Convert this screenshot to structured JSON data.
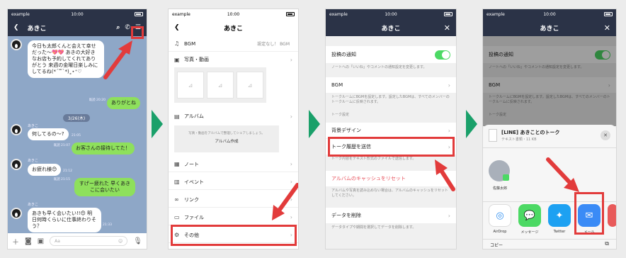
{
  "colors": {
    "accent_red": "#e23b3b",
    "line_green": "#8ee05c",
    "toggle_green": "#4cd964",
    "nav_dark": "#2b3347",
    "step_arrow": "#1aa06a"
  },
  "statusbar": {
    "carrier": "example",
    "time": "10:00"
  },
  "chat": {
    "title": "あきこ",
    "header_icons": [
      "back-chevron-icon",
      "search-icon",
      "phone-icon",
      "menu-icon"
    ],
    "messages": [
      {
        "side": "in",
        "name": "",
        "text": "今日も太郎くんと会えて幸せだった〜💖💖 あきの大好きなお店も予約してくれてありがとう 来週の金曜日楽しみにしてるね(*´꒳`*)˳⋆⁺♡"
      },
      {
        "side": "out",
        "time": "既読 20:20",
        "text": "ありがとね"
      },
      {
        "side": "in",
        "name": "あきこ",
        "text": "何してるの〜?",
        "time": "21:05"
      },
      {
        "side": "out",
        "time": "既読 21:07",
        "text": "お客さんの接待してた！"
      },
      {
        "side": "in",
        "name": "あきこ",
        "text": "お疲れ様😊",
        "time": "21:12"
      },
      {
        "side": "out",
        "time": "既読 21:15",
        "text": "すげー疲れた 早くあきこに会いたい"
      },
      {
        "side": "in",
        "name": "あきこ",
        "text": "あきも早く会いたい!!😊 明日何時くらいに仕事終わりそう？",
        "time": "21:33"
      }
    ],
    "date_separator": "3/26(木)",
    "input_placeholder": "Aa"
  },
  "menu": {
    "title": "あきこ",
    "bgm": {
      "label": "BGM",
      "value": "設定なし！ BGM"
    },
    "photos_label": "写真・動画",
    "album_label": "アルバム",
    "album_hint": "写真・動画をアルバムで整理してシェアしましょう。",
    "album_create": "アルバム作成",
    "items": [
      "ノート",
      "イベント",
      "リンク",
      "ファイル",
      "その他"
    ]
  },
  "settings": {
    "title": "あきこ",
    "post_notify": "投稿の通知",
    "post_notify_desc": "ノートへの「いいね」やコメントの通知設定を変更します。",
    "post_notify_on": true,
    "bgm": "BGM",
    "bgm_desc": "トークルームにBGMを設定します。設定したBGMは、すべてのメンバーのトークルームに反映されます。",
    "section_talk": "トーク設定",
    "background": "背景デザイン",
    "export": "トーク履歴を送信",
    "export_desc": "トーク内容をテキスト形式のファイルで送信します。",
    "clear_album_cache": "アルバムのキャッシュをリセット",
    "clear_album_cache_desc": "アルバムや写真を読み込めない場合は、アルバムのキャッシュをリセットしてください。",
    "delete_data": "データを削除",
    "delete_data_desc": "データタイプや期間を選択してデータを削除します。"
  },
  "share": {
    "file_title": "[LINE] あきことのトーク",
    "file_meta": "テキスト書類・11 KB",
    "contact_name": "佐藤太郎",
    "apps": [
      {
        "label": "AirDrop",
        "icon": "airdrop-icon"
      },
      {
        "label": "メッセージ",
        "icon": "messages-icon"
      },
      {
        "label": "Twitter",
        "icon": "twitter-icon"
      },
      {
        "label": "メール",
        "icon": "mail-icon"
      }
    ],
    "copy_label": "コピー"
  }
}
